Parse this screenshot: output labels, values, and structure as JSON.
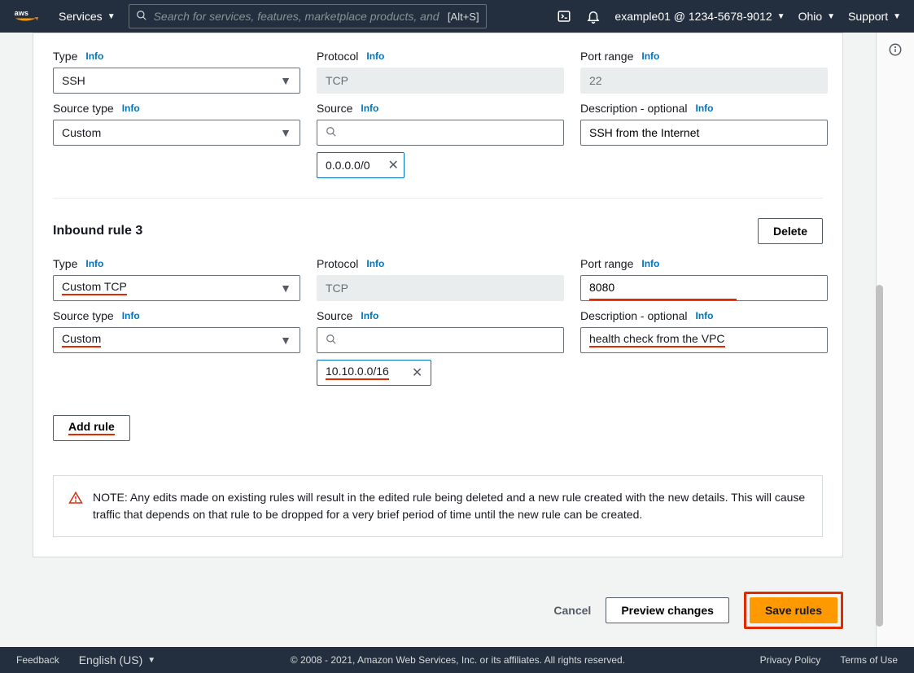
{
  "nav": {
    "services": "Services",
    "search_placeholder": "Search for services, features, marketplace products, and",
    "search_shortcut": "[Alt+S]",
    "account": "example01 @ 1234-5678-9012",
    "region": "Ohio",
    "support": "Support"
  },
  "labels": {
    "type": "Type",
    "protocol": "Protocol",
    "port_range": "Port range",
    "source_type": "Source type",
    "source": "Source",
    "description_optional": "Description - optional",
    "info": "Info"
  },
  "rule2": {
    "type": "SSH",
    "protocol": "TCP",
    "port_range": "22",
    "source_type": "Custom",
    "source_chip": "0.0.0.0/0",
    "description": "SSH from the Internet"
  },
  "rule3": {
    "heading": "Inbound rule 3",
    "delete": "Delete",
    "type": "Custom TCP",
    "protocol": "TCP",
    "port_range": "8080",
    "source_type": "Custom",
    "source_chip": "10.10.0.0/16",
    "description": "health check from the VPC"
  },
  "add_rule": "Add rule",
  "notice": "NOTE: Any edits made on existing rules will result in the edited rule being deleted and a new rule created with the new details. This will cause traffic that depends on that rule to be dropped for a very brief period of time until the new rule can be created.",
  "actions": {
    "cancel": "Cancel",
    "preview": "Preview changes",
    "save": "Save rules"
  },
  "footer": {
    "feedback": "Feedback",
    "language": "English (US)",
    "copyright": "© 2008 - 2021, Amazon Web Services, Inc. or its affiliates. All rights reserved.",
    "privacy": "Privacy Policy",
    "terms": "Terms of Use"
  }
}
